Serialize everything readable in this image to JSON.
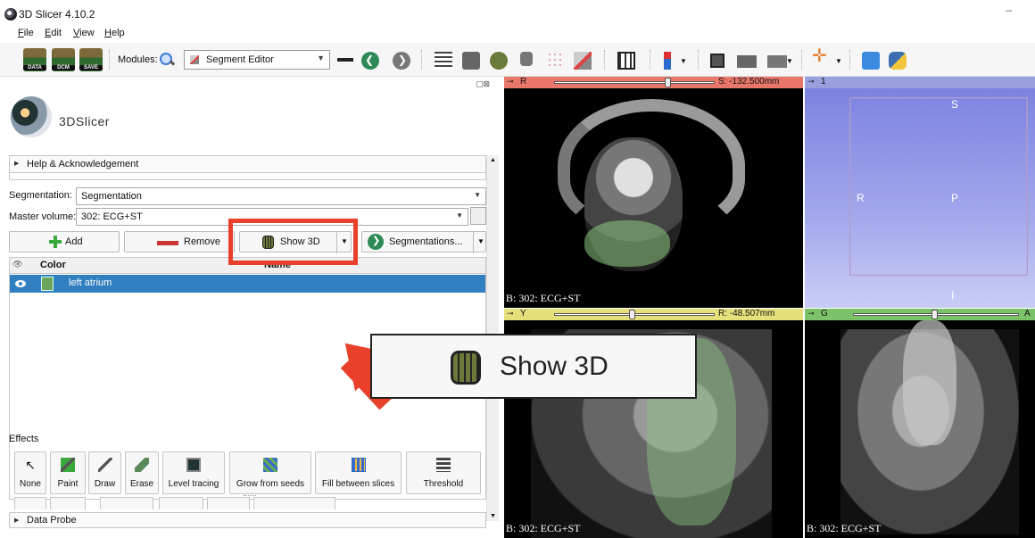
{
  "window": {
    "title": "3D Slicer 4.10.2",
    "minimize": "–"
  },
  "menu": [
    "File",
    "Edit",
    "View",
    "Help"
  ],
  "toolbar": {
    "data_caption": "DATA",
    "dcm_caption": "DCM",
    "save_caption": "SAVE",
    "modules_label": "Modules:",
    "module_selected": "Segment Editor"
  },
  "panel": {
    "logo_text": "3DSlicer",
    "help_section": "Help & Acknowledgement",
    "segmentation_label": "Segmentation:",
    "segmentation_value": "Segmentation",
    "master_label": "Master volume:",
    "master_value": "302: ECG+ST",
    "buttons": {
      "add": "Add",
      "remove": "Remove",
      "show3d": "Show 3D",
      "segmentations": "Segmentations..."
    },
    "table": {
      "headers": {
        "vis": "👁",
        "color": "Color",
        "name": "Name"
      },
      "rows": [
        {
          "name": "left atrium",
          "color": "#6ba55e"
        }
      ]
    },
    "effects_label": "Effects",
    "effects": [
      "None",
      "Paint",
      "Draw",
      "Erase",
      "Level tracing",
      "Grow from seeds",
      "Fill between slices",
      "Threshold"
    ],
    "data_probe": "Data Probe"
  },
  "views": {
    "red": {
      "letter": "R",
      "value": "S: -132.500mm",
      "label": "B: 302: ECG+ST",
      "color": "#e8776a"
    },
    "threed": {
      "letter": "1",
      "color": "#9aa0de",
      "orient_s": "S",
      "orient_r": "R",
      "orient_p": "P",
      "orient_i": "I"
    },
    "yellow": {
      "letter": "Y",
      "value": "R: -48.507mm",
      "label": "B: 302: ECG+ST",
      "color": "#e6e07a"
    },
    "green": {
      "letter": "G",
      "value": "A",
      "label": "B: 302: ECG+ST",
      "color": "#7cc26a"
    }
  },
  "callout": {
    "text": "Show 3D"
  }
}
